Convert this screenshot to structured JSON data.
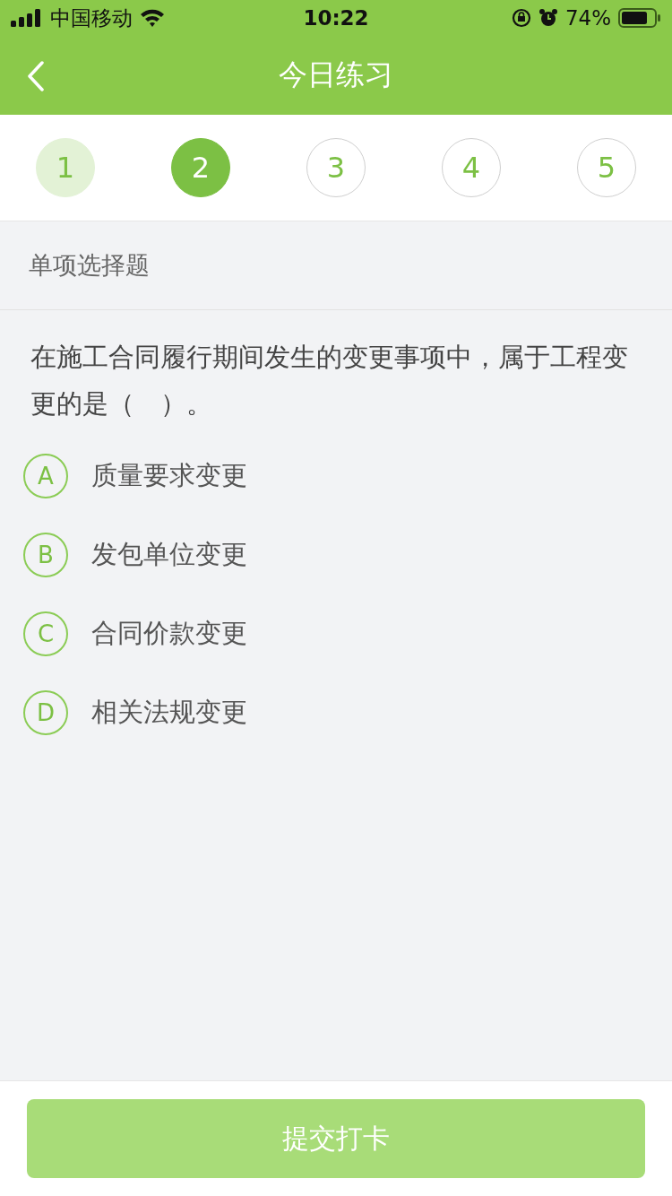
{
  "status_bar": {
    "carrier": "中国移动",
    "time": "10:22",
    "battery": "74%"
  },
  "nav": {
    "title": "今日练习"
  },
  "steps": [
    {
      "label": "1",
      "selected": false,
      "answered": true
    },
    {
      "label": "2",
      "selected": true,
      "answered": false
    },
    {
      "label": "3",
      "selected": false,
      "answered": false
    },
    {
      "label": "4",
      "selected": false,
      "answered": false
    },
    {
      "label": "5",
      "selected": false,
      "answered": false
    }
  ],
  "section": {
    "title": "单项选择题"
  },
  "question": {
    "text": "在施工合同履行期间发生的变更事项中，属于工程变更的是（　）。"
  },
  "options": [
    {
      "letter": "A",
      "text": "质量要求变更",
      "selected": false
    },
    {
      "letter": "B",
      "text": "发包单位变更",
      "selected": false
    },
    {
      "letter": "C",
      "text": "合同价款变更",
      "selected": false
    },
    {
      "letter": "D",
      "text": "相关法规变更",
      "selected": false
    }
  ],
  "submit": {
    "label": "提交打卡",
    "disabled": true
  }
}
